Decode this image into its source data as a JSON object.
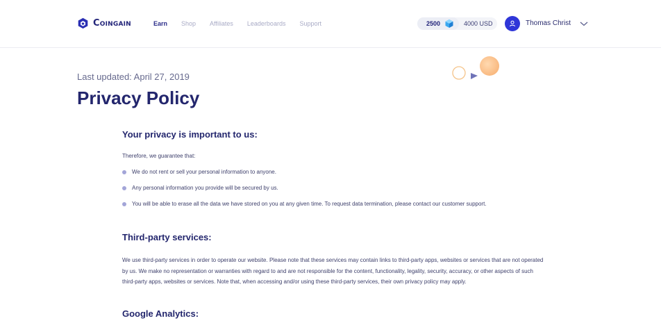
{
  "brand": {
    "name": "Coingain"
  },
  "nav": {
    "items": [
      {
        "label": "Earn",
        "active": true
      },
      {
        "label": "Shop",
        "active": false
      },
      {
        "label": "Affiliates",
        "active": false
      },
      {
        "label": "Leaderboards",
        "active": false
      },
      {
        "label": "Support",
        "active": false
      }
    ]
  },
  "balance": {
    "coins": "2500",
    "usd": "4000 USD"
  },
  "user": {
    "name": "Thomas Christ"
  },
  "page": {
    "last_updated": "Last updated: April 27, 2019",
    "title": "Privacy Policy"
  },
  "sections": {
    "privacy": {
      "heading": "Your privacy is important to us:",
      "intro": "Therefore, we guarantee that:",
      "bullets": [
        "We do not rent or sell your personal information to anyone.",
        "Any personal information you provide will be secured by us.",
        "You will be able to erase all the data we have stored on you at any given time. To request data termination, please contact our customer support."
      ]
    },
    "third_party": {
      "heading": "Third-party services:",
      "body": "We use third-party services in order to operate our website. Please note that these services may contain links to third-party apps, websites or services that are not operated by us. We make no representation or warranties with regard to and are not responsible for the content, functionality, legality, security, accuracy, or other aspects of such third-party apps, websites or services. Note that, when accessing and/or using these third-party services, their own privacy policy may apply."
    },
    "analytics": {
      "heading": "Google Analytics:"
    }
  },
  "colors": {
    "brand": "#23257a",
    "avatar": "#2f36d8",
    "bullet": "#a3a5d8",
    "nav_inactive": "#a9abc6"
  },
  "icons": {
    "logo": "cube-logo-icon",
    "coin": "gem-icon",
    "avatar": "user-icon",
    "menu": "chevron-down-icon"
  }
}
